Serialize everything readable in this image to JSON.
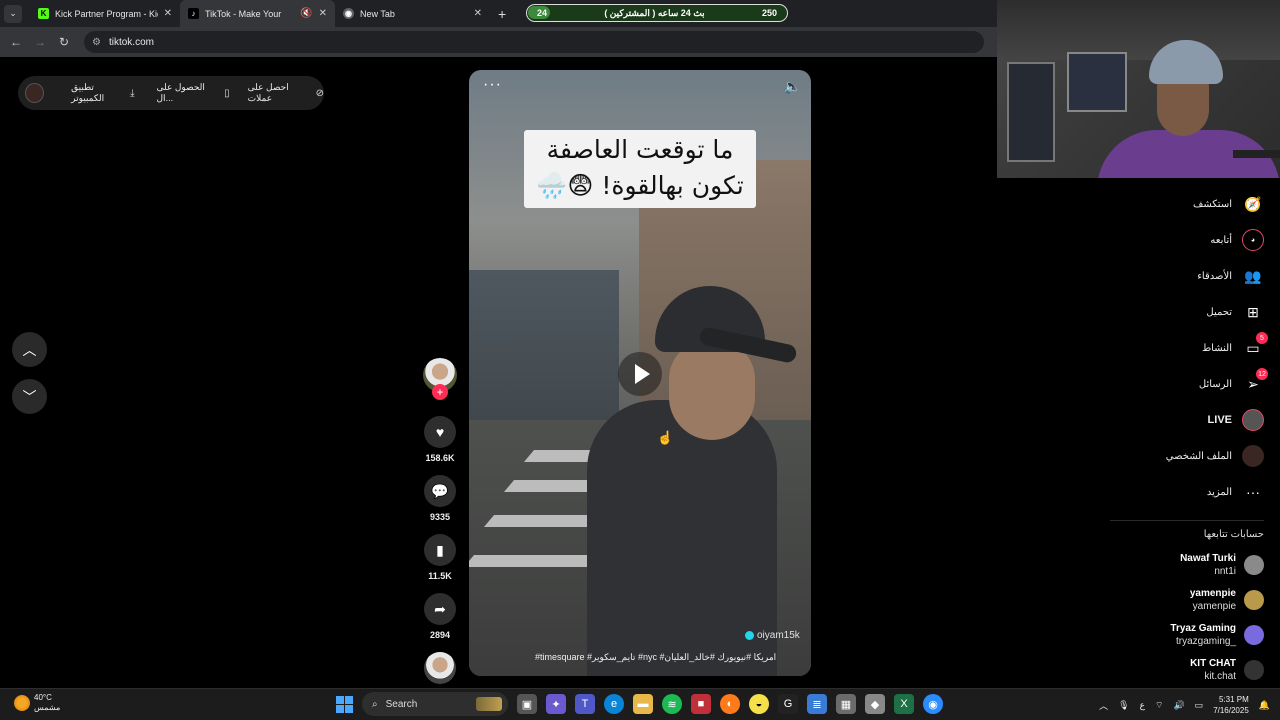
{
  "browser": {
    "tabs": [
      {
        "title": "Kick Partner Program - Kick Da",
        "favicon": "kick-icon",
        "active": false
      },
      {
        "title": "TikTok - Make Your Day",
        "favicon": "tiktok-icon",
        "active": true
      },
      {
        "title": "New Tab",
        "favicon": "chrome-icon",
        "active": false
      }
    ],
    "url": "tiktok.com"
  },
  "counter": {
    "left": "24",
    "center": "بث 24 ساعه ( المشتركين )",
    "right": "250"
  },
  "topbar": {
    "coins": "احصل على عملات",
    "get_app": "الحصول على ال...",
    "desktop_app": "تطبيق الكمبيوتر"
  },
  "video": {
    "caption_line1": "ما توقعت العاصفة",
    "caption_line2": "تكون بهالقوة! 😨🌧️",
    "username": "oiyam15k",
    "hashtags": "#timesquare #تايم_سكوير #nyc #امريكا #نيويورك #خالد_العليان"
  },
  "actions": {
    "likes": "158.6K",
    "comments": "9335",
    "saves": "11.5K",
    "shares": "2894"
  },
  "sidebar": {
    "items": [
      {
        "label": "استكشف",
        "icon": "compass-icon"
      },
      {
        "label": "أتابعه",
        "icon": "following-icon"
      },
      {
        "label": "الأصدقاء",
        "icon": "friends-icon"
      },
      {
        "label": "تحميل",
        "icon": "upload-icon"
      },
      {
        "label": "النشاط",
        "icon": "activity-icon",
        "badge": "5"
      },
      {
        "label": "الرسائل",
        "icon": "messages-icon",
        "badge": "12"
      },
      {
        "label": "LIVE",
        "icon": "live-icon"
      },
      {
        "label": "الملف الشخصي",
        "icon": "profile-icon"
      },
      {
        "label": "المزيد",
        "icon": "more-icon"
      }
    ],
    "following_header": "حسابات تتابعها",
    "accounts": [
      {
        "name": "Nawaf Turki",
        "handle": "nnt1i",
        "color": "#8a8a8a"
      },
      {
        "name": "yamenpie",
        "handle": "yamenpie",
        "color": "#b89a4a"
      },
      {
        "name": "Tryaz Gaming",
        "handle": "_tryazgaming",
        "color": "#7a6ae0"
      },
      {
        "name": "KIT CHAT",
        "handle": "kit.chat",
        "color": "#333333"
      }
    ]
  },
  "taskbar": {
    "temp": "40°C",
    "weather": "مشمس",
    "search": "Search",
    "time": "5:31 PM",
    "date": "7/16/2025",
    "lang": "ع"
  }
}
